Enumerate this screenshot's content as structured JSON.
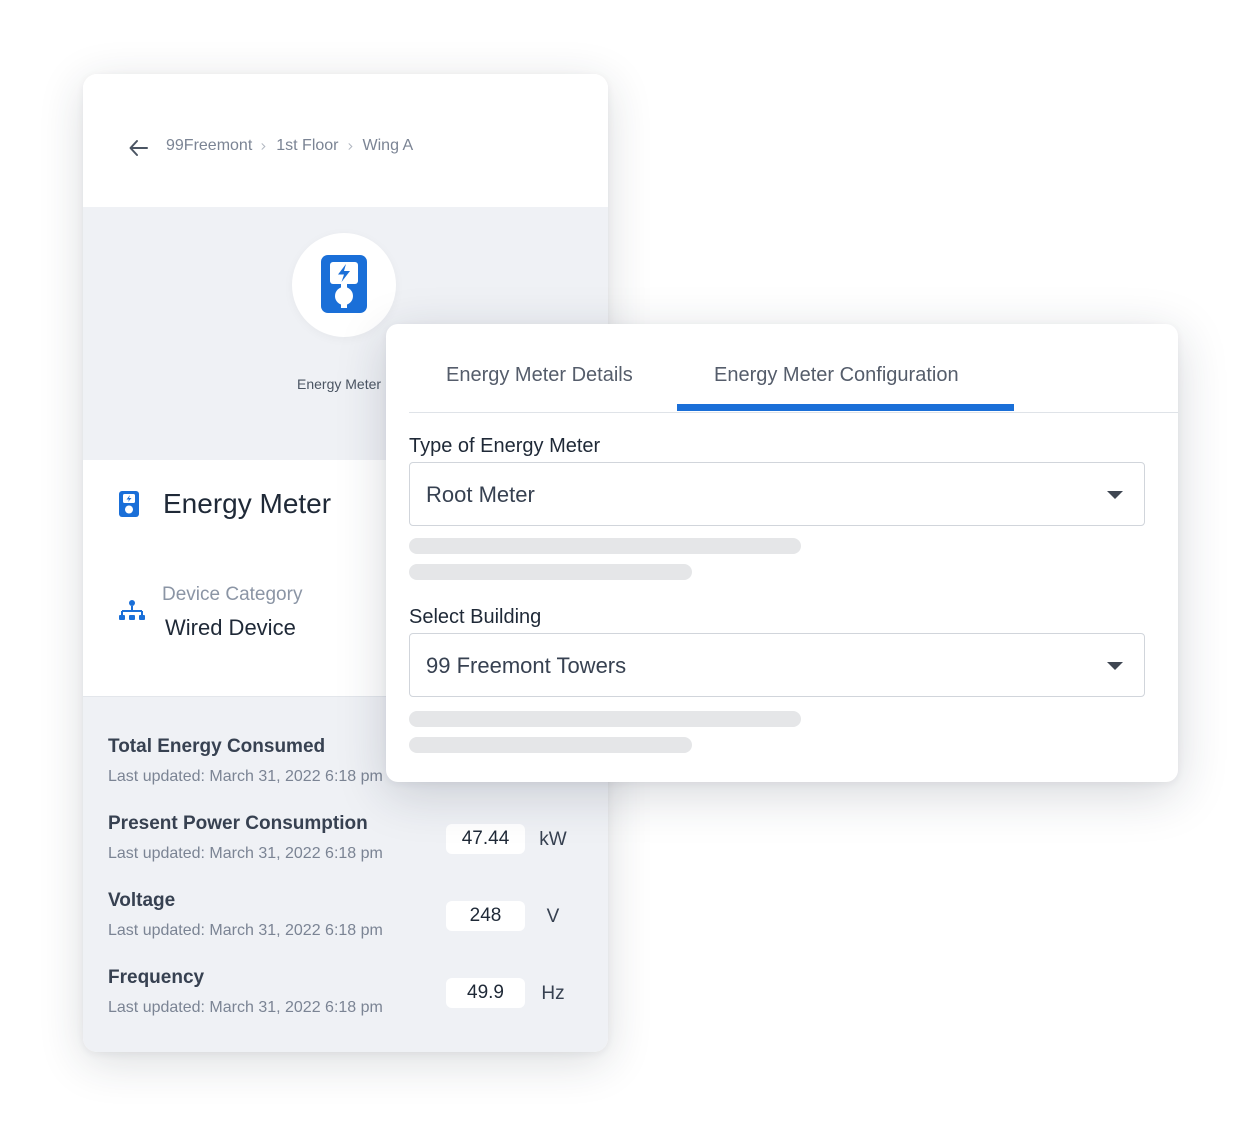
{
  "breadcrumb": {
    "items": [
      "99Freemont",
      "1st Floor",
      "Wing A"
    ]
  },
  "hero": {
    "label": "Energy Meter"
  },
  "device": {
    "title": "Energy Meter",
    "category_label": "Device Category",
    "category_value": "Wired Device"
  },
  "readings": [
    {
      "name": "Total Energy Consumed",
      "updated": "Last updated: March 31, 2022 6:18 pm"
    },
    {
      "name": "Present Power Consumption",
      "updated": "Last updated: March 31, 2022 6:18 pm",
      "value": "47.44",
      "unit": "kW"
    },
    {
      "name": "Voltage",
      "updated": "Last updated: March 31, 2022 6:18 pm",
      "value": "248",
      "unit": "V"
    },
    {
      "name": "Frequency",
      "updated": "Last updated: March 31, 2022 6:18 pm",
      "value": "49.9",
      "unit": "Hz"
    }
  ],
  "config": {
    "tabs": [
      {
        "label": "Energy Meter Details",
        "active": false
      },
      {
        "label": "Energy Meter Configuration",
        "active": true
      }
    ],
    "meter_type": {
      "label": "Type of Energy Meter",
      "value": "Root Meter"
    },
    "building": {
      "label": "Select Building",
      "value": "99 Freemont Towers"
    }
  },
  "colors": {
    "accent": "#1a6fd8",
    "panel_background": "#eff1f5",
    "skeleton": "#e5e6e8"
  },
  "icons": {
    "back": "arrow-left-icon",
    "breadcrumb_separator": "chevron-right-icon",
    "device": "energy-meter-icon",
    "category": "wired-network-icon",
    "dropdown": "caret-down-icon"
  }
}
